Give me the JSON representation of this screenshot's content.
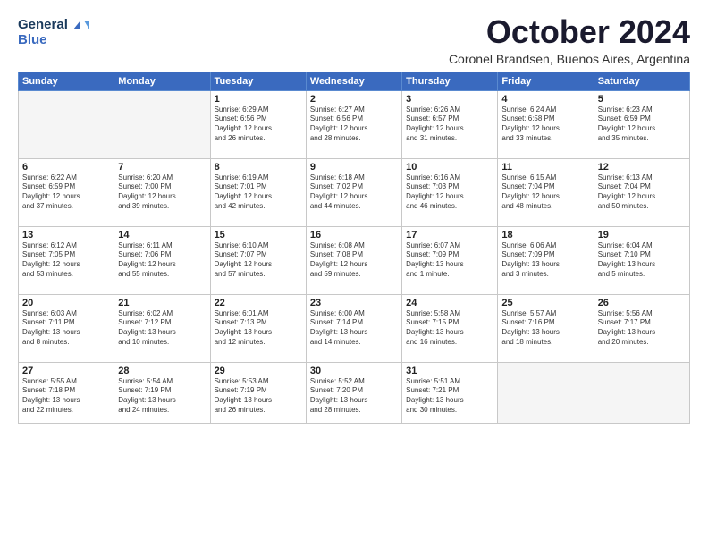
{
  "header": {
    "logo_line1": "General",
    "logo_line2": "Blue",
    "month": "October 2024",
    "location": "Coronel Brandsen, Buenos Aires, Argentina"
  },
  "weekdays": [
    "Sunday",
    "Monday",
    "Tuesday",
    "Wednesday",
    "Thursday",
    "Friday",
    "Saturday"
  ],
  "weeks": [
    [
      {
        "num": "",
        "detail": ""
      },
      {
        "num": "",
        "detail": ""
      },
      {
        "num": "1",
        "detail": "Sunrise: 6:29 AM\nSunset: 6:56 PM\nDaylight: 12 hours\nand 26 minutes."
      },
      {
        "num": "2",
        "detail": "Sunrise: 6:27 AM\nSunset: 6:56 PM\nDaylight: 12 hours\nand 28 minutes."
      },
      {
        "num": "3",
        "detail": "Sunrise: 6:26 AM\nSunset: 6:57 PM\nDaylight: 12 hours\nand 31 minutes."
      },
      {
        "num": "4",
        "detail": "Sunrise: 6:24 AM\nSunset: 6:58 PM\nDaylight: 12 hours\nand 33 minutes."
      },
      {
        "num": "5",
        "detail": "Sunrise: 6:23 AM\nSunset: 6:59 PM\nDaylight: 12 hours\nand 35 minutes."
      }
    ],
    [
      {
        "num": "6",
        "detail": "Sunrise: 6:22 AM\nSunset: 6:59 PM\nDaylight: 12 hours\nand 37 minutes."
      },
      {
        "num": "7",
        "detail": "Sunrise: 6:20 AM\nSunset: 7:00 PM\nDaylight: 12 hours\nand 39 minutes."
      },
      {
        "num": "8",
        "detail": "Sunrise: 6:19 AM\nSunset: 7:01 PM\nDaylight: 12 hours\nand 42 minutes."
      },
      {
        "num": "9",
        "detail": "Sunrise: 6:18 AM\nSunset: 7:02 PM\nDaylight: 12 hours\nand 44 minutes."
      },
      {
        "num": "10",
        "detail": "Sunrise: 6:16 AM\nSunset: 7:03 PM\nDaylight: 12 hours\nand 46 minutes."
      },
      {
        "num": "11",
        "detail": "Sunrise: 6:15 AM\nSunset: 7:04 PM\nDaylight: 12 hours\nand 48 minutes."
      },
      {
        "num": "12",
        "detail": "Sunrise: 6:13 AM\nSunset: 7:04 PM\nDaylight: 12 hours\nand 50 minutes."
      }
    ],
    [
      {
        "num": "13",
        "detail": "Sunrise: 6:12 AM\nSunset: 7:05 PM\nDaylight: 12 hours\nand 53 minutes."
      },
      {
        "num": "14",
        "detail": "Sunrise: 6:11 AM\nSunset: 7:06 PM\nDaylight: 12 hours\nand 55 minutes."
      },
      {
        "num": "15",
        "detail": "Sunrise: 6:10 AM\nSunset: 7:07 PM\nDaylight: 12 hours\nand 57 minutes."
      },
      {
        "num": "16",
        "detail": "Sunrise: 6:08 AM\nSunset: 7:08 PM\nDaylight: 12 hours\nand 59 minutes."
      },
      {
        "num": "17",
        "detail": "Sunrise: 6:07 AM\nSunset: 7:09 PM\nDaylight: 13 hours\nand 1 minute."
      },
      {
        "num": "18",
        "detail": "Sunrise: 6:06 AM\nSunset: 7:09 PM\nDaylight: 13 hours\nand 3 minutes."
      },
      {
        "num": "19",
        "detail": "Sunrise: 6:04 AM\nSunset: 7:10 PM\nDaylight: 13 hours\nand 5 minutes."
      }
    ],
    [
      {
        "num": "20",
        "detail": "Sunrise: 6:03 AM\nSunset: 7:11 PM\nDaylight: 13 hours\nand 8 minutes."
      },
      {
        "num": "21",
        "detail": "Sunrise: 6:02 AM\nSunset: 7:12 PM\nDaylight: 13 hours\nand 10 minutes."
      },
      {
        "num": "22",
        "detail": "Sunrise: 6:01 AM\nSunset: 7:13 PM\nDaylight: 13 hours\nand 12 minutes."
      },
      {
        "num": "23",
        "detail": "Sunrise: 6:00 AM\nSunset: 7:14 PM\nDaylight: 13 hours\nand 14 minutes."
      },
      {
        "num": "24",
        "detail": "Sunrise: 5:58 AM\nSunset: 7:15 PM\nDaylight: 13 hours\nand 16 minutes."
      },
      {
        "num": "25",
        "detail": "Sunrise: 5:57 AM\nSunset: 7:16 PM\nDaylight: 13 hours\nand 18 minutes."
      },
      {
        "num": "26",
        "detail": "Sunrise: 5:56 AM\nSunset: 7:17 PM\nDaylight: 13 hours\nand 20 minutes."
      }
    ],
    [
      {
        "num": "27",
        "detail": "Sunrise: 5:55 AM\nSunset: 7:18 PM\nDaylight: 13 hours\nand 22 minutes."
      },
      {
        "num": "28",
        "detail": "Sunrise: 5:54 AM\nSunset: 7:19 PM\nDaylight: 13 hours\nand 24 minutes."
      },
      {
        "num": "29",
        "detail": "Sunrise: 5:53 AM\nSunset: 7:19 PM\nDaylight: 13 hours\nand 26 minutes."
      },
      {
        "num": "30",
        "detail": "Sunrise: 5:52 AM\nSunset: 7:20 PM\nDaylight: 13 hours\nand 28 minutes."
      },
      {
        "num": "31",
        "detail": "Sunrise: 5:51 AM\nSunset: 7:21 PM\nDaylight: 13 hours\nand 30 minutes."
      },
      {
        "num": "",
        "detail": ""
      },
      {
        "num": "",
        "detail": ""
      }
    ]
  ]
}
